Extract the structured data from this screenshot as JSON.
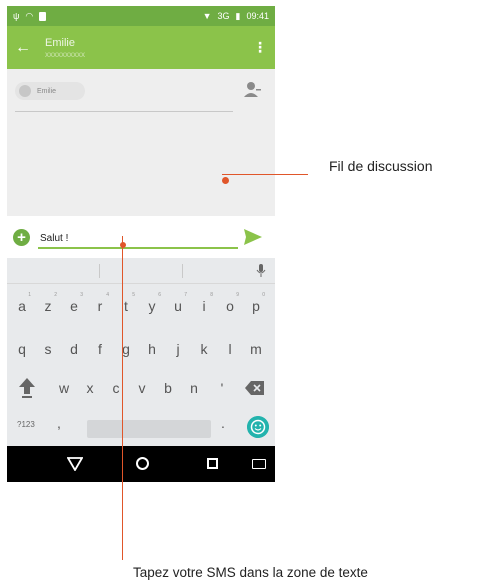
{
  "status_bar": {
    "network": "3G",
    "time": "09:41"
  },
  "app_bar": {
    "contact_name": "Emilie",
    "contact_number": "xxxxxxxxxx"
  },
  "thread": {
    "recipient_chip": "Emilie"
  },
  "compose": {
    "message_text": "Salut !"
  },
  "keyboard": {
    "row1": [
      "a",
      "z",
      "e",
      "r",
      "t",
      "y",
      "u",
      "i",
      "o",
      "p"
    ],
    "row1_hints": [
      "1",
      "2",
      "3",
      "4",
      "5",
      "6",
      "7",
      "8",
      "9",
      "0"
    ],
    "row2": [
      "q",
      "s",
      "d",
      "f",
      "g",
      "h",
      "j",
      "k",
      "l",
      "m"
    ],
    "row3": [
      "w",
      "x",
      "c",
      "v",
      "b",
      "n",
      "'"
    ],
    "numbers_key": "?123",
    "comma_key": ",",
    "period_key": "."
  },
  "annotations": {
    "thread_label": "Fil de discussion",
    "input_label": "Tapez votre SMS dans la zone de texte"
  },
  "colors": {
    "status_bar": "#6fad43",
    "app_bar": "#8bc34a",
    "accent": "#8bc34a",
    "leader_line": "#e0562a",
    "emoji_key": "#23b3ad",
    "nav_bar": "#000000"
  },
  "icons": [
    "back-arrow-icon",
    "overflow-menu-icon",
    "add-contact-icon",
    "plus-icon",
    "send-icon",
    "mic-icon",
    "shift-icon",
    "delete-icon",
    "emoji-icon",
    "nav-back-icon",
    "nav-home-icon",
    "nav-recents-icon",
    "nav-keyboard-icon"
  ]
}
